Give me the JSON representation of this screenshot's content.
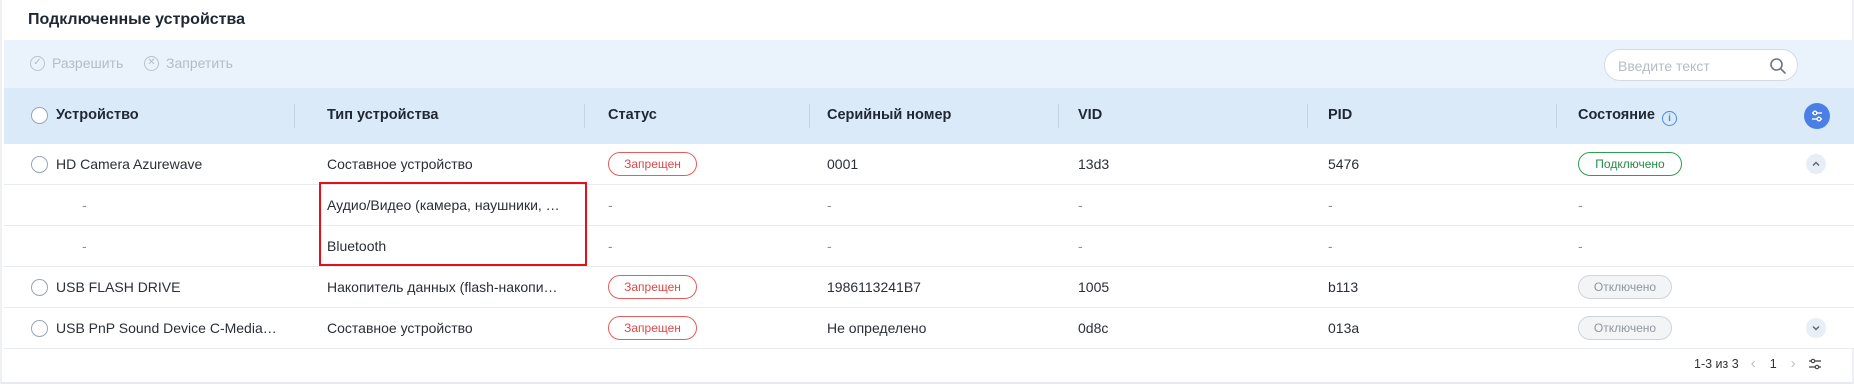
{
  "title": "Подключенные устройства",
  "toolbar": {
    "allow_label": "Разрешить",
    "deny_label": "Запретить",
    "search_placeholder": "Введите текст"
  },
  "columns": {
    "device": "Устройство",
    "type": "Тип устройства",
    "status": "Статус",
    "serial": "Серийный номер",
    "vid": "VID",
    "pid": "PID",
    "state": "Состояние"
  },
  "rows": [
    {
      "device": "HD Camera Azurewave",
      "type": "Составное устройство",
      "status": "Запрещен",
      "serial": "0001",
      "vid": "13d3",
      "pid": "5476",
      "state": "Подключено"
    },
    {
      "device": "-",
      "type": "Аудио/Видео (камера, наушники, …",
      "status": "-",
      "serial": "-",
      "vid": "-",
      "pid": "-",
      "state": "-"
    },
    {
      "device": "-",
      "type": "Bluetooth",
      "status": "-",
      "serial": "-",
      "vid": "-",
      "pid": "-",
      "state": "-"
    },
    {
      "device": "USB FLASH DRIVE",
      "type": "Накопитель данных (flash-накопи…",
      "status": "Запрещен",
      "serial": "1986113241B7",
      "vid": "1005",
      "pid": "b113",
      "state": "Отключено"
    },
    {
      "device": "USB PnP Sound Device C-Media…",
      "type": "Составное устройство",
      "status": "Запрещен",
      "serial": "Не определено",
      "vid": "0d8c",
      "pid": "013a",
      "state": "Отключено"
    }
  ],
  "footer": {
    "range": "1-3 из 3",
    "page": "1"
  },
  "colors": {
    "accent": "#4a80e6",
    "denied": "#e04848",
    "connected": "#238a45",
    "highlight": "#e3101a"
  }
}
